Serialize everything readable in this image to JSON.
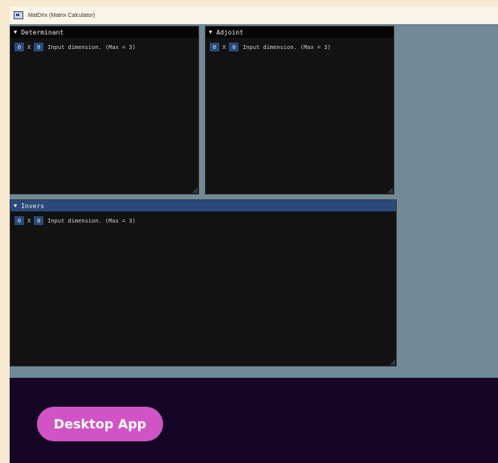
{
  "window": {
    "title": "MatDrix (Matrix Calculator)"
  },
  "panels": {
    "determinant": {
      "title": "Determinant",
      "rows": "0",
      "cols": "0",
      "times": "X",
      "hint": "Input dimension. (Max = 3)"
    },
    "adjoint": {
      "title": "Adjoint",
      "rows": "0",
      "cols": "0",
      "times": "X",
      "hint": "Input dimension. (Max = 3)"
    },
    "invers": {
      "title": "Invers",
      "rows": "0",
      "cols": "0",
      "times": "X",
      "hint": "Input dimension. (Max = 3)"
    }
  },
  "icons": {
    "collapse": "triangle-down-icon",
    "app": "window-icon"
  },
  "footer": {
    "button_label": "Desktop App"
  },
  "colors": {
    "accent": "#294a7a",
    "workspace": "#728a97",
    "button": "#d054c6",
    "footer": "#150625"
  }
}
